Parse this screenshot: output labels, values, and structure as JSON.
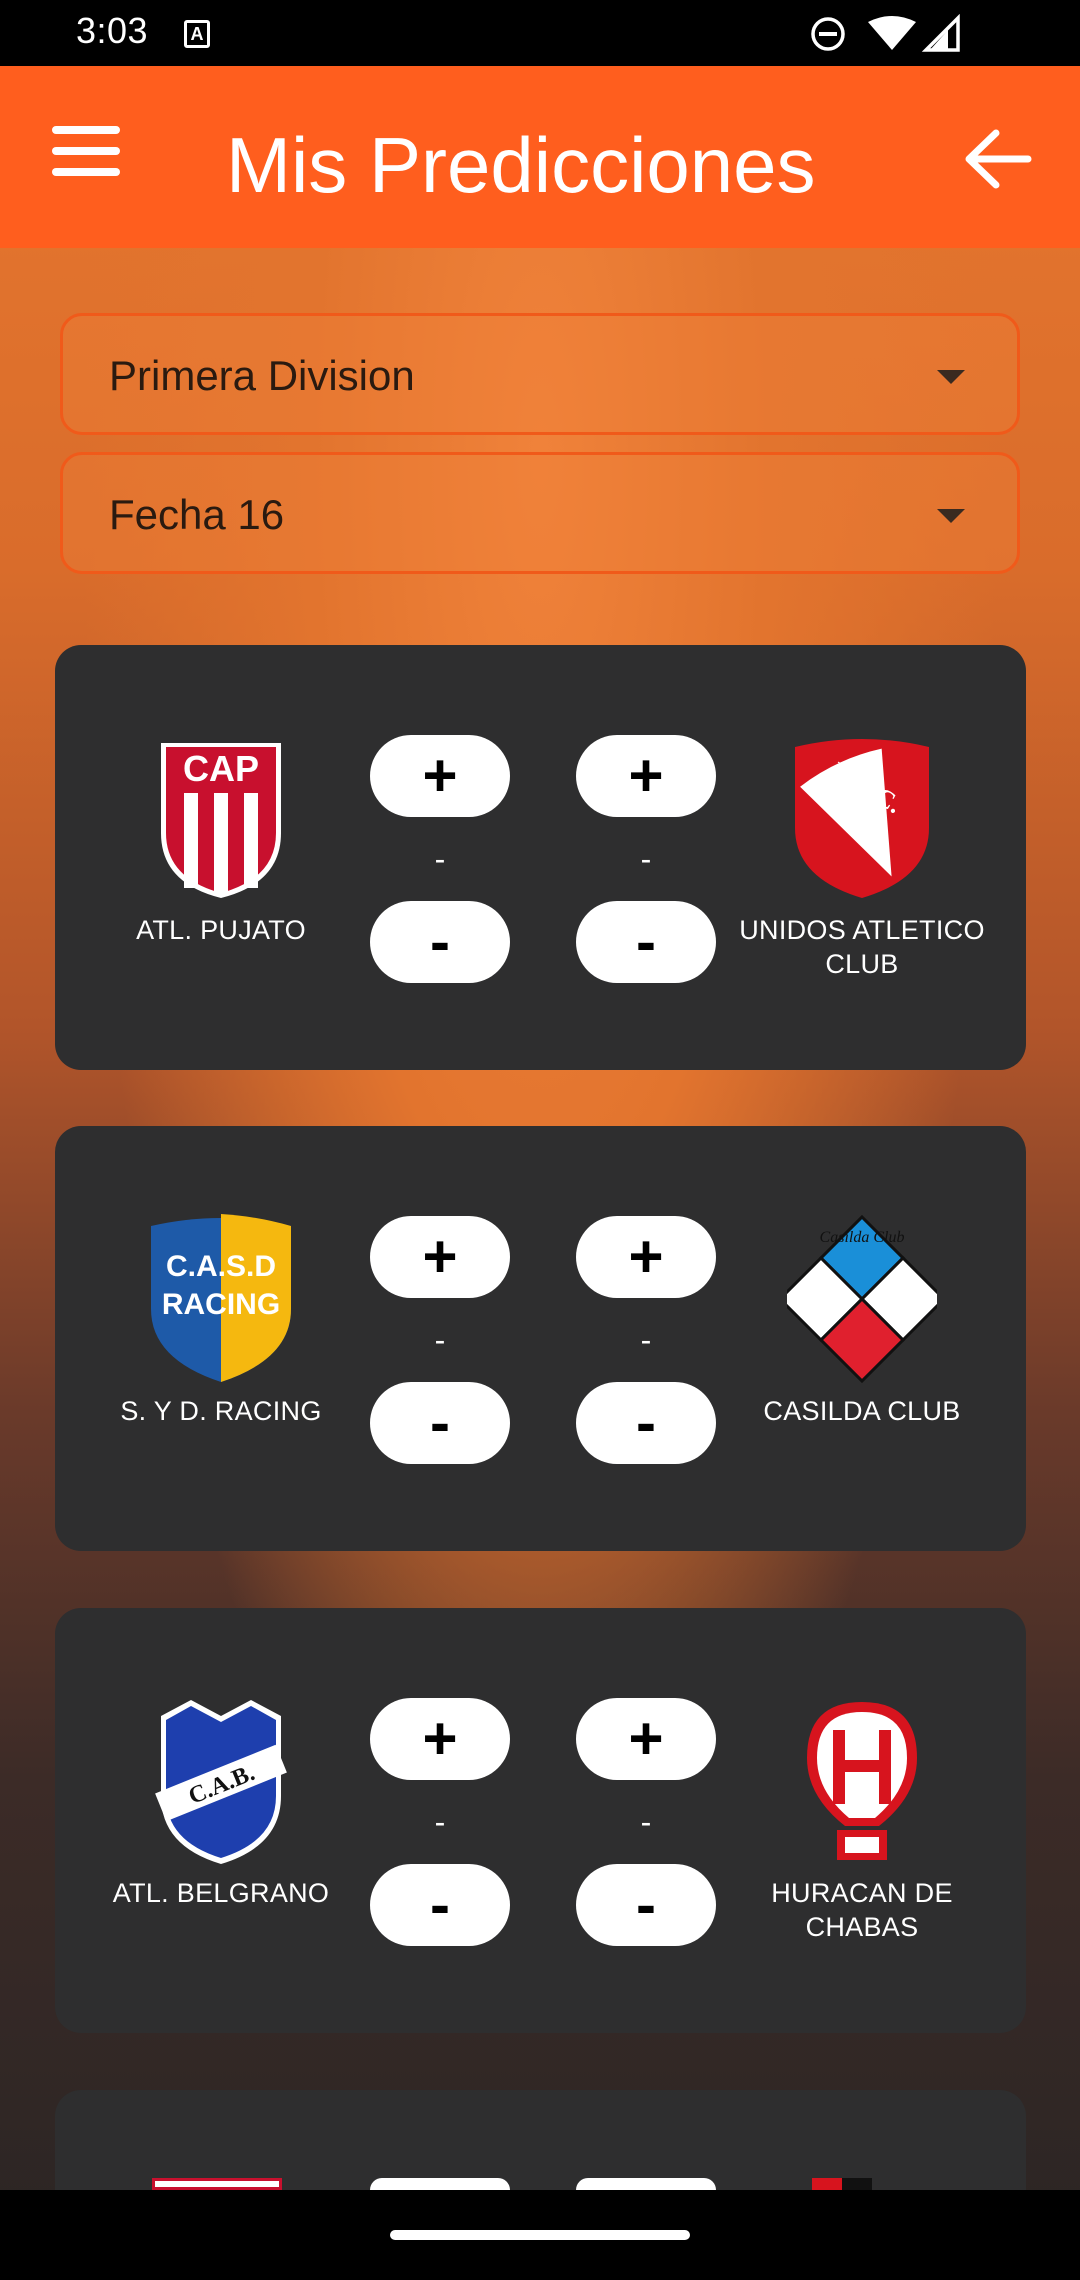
{
  "status": {
    "time": "3:03",
    "notification_icon": "a-letter-icon",
    "icons": [
      "do-not-disturb-icon",
      "wifi-icon",
      "signal-icon"
    ]
  },
  "appbar": {
    "title": "Mis Predicciones",
    "menu_icon": "hamburger-menu-icon",
    "back_icon": "arrow-left-icon",
    "color": "#ff5e1e"
  },
  "filters": {
    "league": "Primera Division",
    "round": "Fecha 16"
  },
  "matches": [
    {
      "home": {
        "name": "ATL. PUJATO",
        "crest": "cap-crest-icon"
      },
      "away": {
        "name": "UNIDOS ATLETICO CLUB",
        "crest": "uac-crest-icon"
      },
      "home_score": "-",
      "away_score": "-"
    },
    {
      "home": {
        "name": "S. Y D. RACING",
        "crest": "casd-racing-crest-icon"
      },
      "away": {
        "name": "CASILDA CLUB",
        "crest": "casilda-club-crest-icon"
      },
      "home_score": "-",
      "away_score": "-"
    },
    {
      "home": {
        "name": "ATL. BELGRANO",
        "crest": "cab-crest-icon"
      },
      "away": {
        "name": "HURACAN DE CHABAS",
        "crest": "huracan-crest-icon"
      },
      "home_score": "-",
      "away_score": "-"
    }
  ],
  "controls": {
    "plus": "+",
    "minus": "-"
  },
  "crest_text": {
    "cap": "CAP",
    "uac": "U.A.C.",
    "casd": "C.A.S.D",
    "racing": "RACING",
    "casilda": "Casilda Club",
    "cab": "C.A.B."
  }
}
